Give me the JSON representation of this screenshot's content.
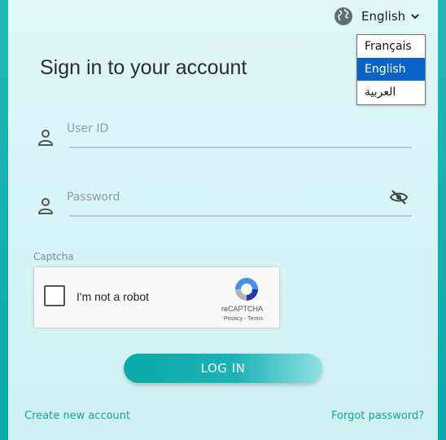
{
  "header": {
    "language_selected": "English"
  },
  "language_options": [
    "Français",
    "English",
    "العربية"
  ],
  "title": "Sign in to your account",
  "form": {
    "user_id_label": "User ID",
    "password_label": "Password"
  },
  "captcha": {
    "label": "Captcha",
    "checkbox_text": "I'm not a robot",
    "brand": "reCAPTCHA",
    "links": "Privacy - Terms"
  },
  "login_button": "LOG IN",
  "links": {
    "create_account": "Create new account",
    "forgot_password": "Forgot password?"
  },
  "icons": {
    "globe": "globe-icon",
    "user": "user-icon",
    "eye_off": "eye-off-icon",
    "chevron": "chevron-down-icon",
    "recaptcha": "recaptcha-logo-icon"
  },
  "colors": {
    "accent": "#1fb3b5",
    "link": "#12a3a6",
    "selected_option": "#0a63c9"
  }
}
